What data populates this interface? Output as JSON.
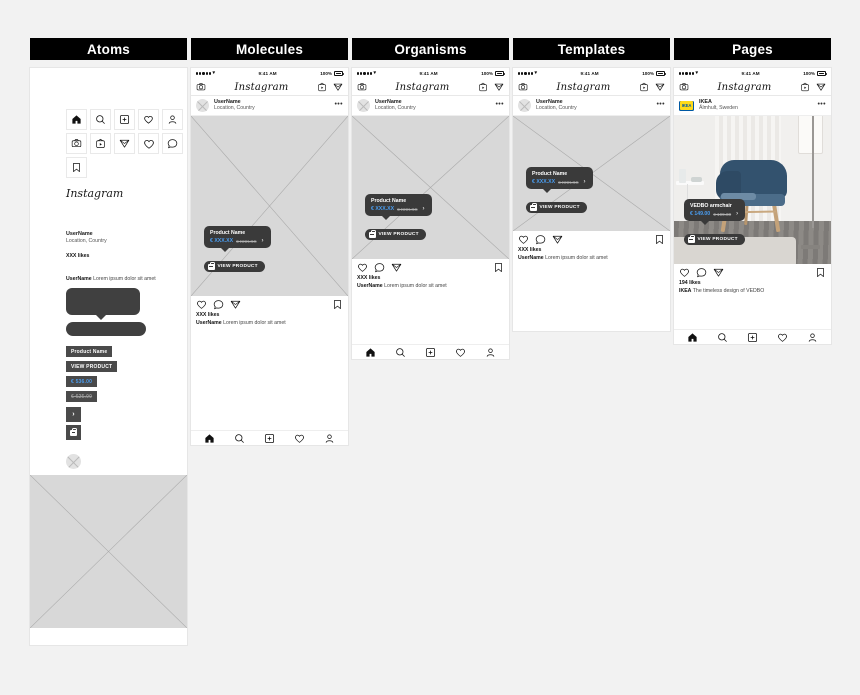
{
  "board": {
    "background": "#f2f2f2",
    "columns": [
      {
        "key": "atoms",
        "label": "Atoms"
      },
      {
        "key": "molecules",
        "label": "Molecules"
      },
      {
        "key": "organisms",
        "label": "Organisms"
      },
      {
        "key": "templates",
        "label": "Templates"
      },
      {
        "key": "pages",
        "label": "Pages"
      }
    ]
  },
  "statusbar": {
    "time": "9:41 AM",
    "battery": "100%",
    "wifi_icon": "wifi-icon",
    "signal_icon": "signal-dots-icon",
    "battery_icon": "battery-full-icon"
  },
  "ignav": {
    "logo": "Instagram",
    "camera_icon": "camera-icon",
    "igtv_icon": "igtv-icon",
    "send_icon": "send-icon"
  },
  "post": {
    "username": "UserName",
    "location": "Location, Country",
    "more_icon": "ellipsis-icon",
    "avatar_icon": "avatar-placeholder-icon",
    "likes": "XXX likes",
    "caption_user": "UserName",
    "caption_text": "Lorem ipsum dolor sit amet",
    "like_icon": "heart-icon",
    "comment_icon": "comment-icon",
    "share_icon": "send-icon",
    "save_icon": "bookmark-icon"
  },
  "product": {
    "name": "Product Name",
    "price_new": "€ XXX.XX",
    "price_old": "€ XXX.XX",
    "arrow": "›",
    "cta": "VIEW PRODUCT",
    "bag_icon": "shopping-bag-icon",
    "accent_color": "#4a9df0",
    "bubble_color": "#3a3a3a"
  },
  "tabbar": {
    "home_icon": "home-icon",
    "search_icon": "search-icon",
    "add_icon": "add-post-icon",
    "activity_icon": "heart-icon",
    "profile_icon": "person-icon"
  },
  "atoms": {
    "icons_row1": [
      {
        "name": "home-icon",
        "label": "Home"
      },
      {
        "name": "search-icon",
        "label": "Search"
      },
      {
        "name": "add-post-icon",
        "label": "Add Post"
      },
      {
        "name": "heart-icon",
        "label": "Activity"
      },
      {
        "name": "person-icon",
        "label": "Profile"
      },
      {
        "name": "ellipsis-icon",
        "label": "More"
      }
    ],
    "icons_row2": [
      {
        "name": "camera-icon",
        "label": "Camera"
      },
      {
        "name": "igtv-icon",
        "label": "IGTV"
      },
      {
        "name": "send-icon",
        "label": "Direct"
      },
      {
        "name": "heart-icon",
        "label": "Like"
      },
      {
        "name": "comment-icon",
        "label": "Comment"
      },
      {
        "name": "share-icon",
        "label": "Share"
      }
    ],
    "icons_row3": [
      {
        "name": "bookmark-icon",
        "label": "Save"
      }
    ],
    "wordmark": "Instagram",
    "username": "UserName",
    "location": "Location, Country",
    "likes": "XXX likes",
    "caption_user": "UserName",
    "caption_text": "Lorem ipsum dolor sit amet",
    "chips": {
      "product_name": "Product Name",
      "view_product": "VIEW PRODUCT",
      "price_new": "€ 536.00",
      "price_old": "€ 625.00",
      "arrow": "›",
      "bag_icon": "shopping-bag-icon"
    },
    "avatar_icon": "avatar-placeholder-icon",
    "image_placeholder_icon": "image-placeholder-icon"
  },
  "pages": {
    "username": "IKEA",
    "location": "Älmhult, Sweden",
    "brand_mark": "IKEA",
    "likes": "194 likes",
    "caption_user": "IKEA",
    "caption_text": "The timeless design of VEDBO",
    "product": {
      "name": "VEDBO armchair",
      "price_new": "€ 149.00",
      "price_old": "€ 199.00",
      "arrow": "›",
      "cta": "VIEW PRODUCT"
    },
    "photo_alt": "blue-armchair-in-living-room"
  }
}
